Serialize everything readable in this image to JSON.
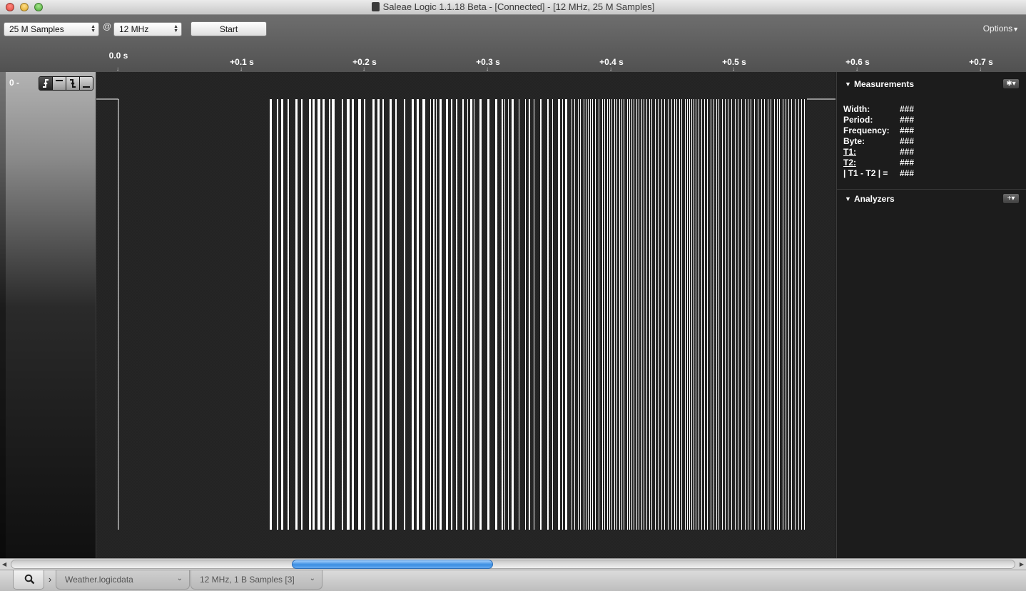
{
  "window": {
    "title": "Saleae Logic 1.1.18 Beta - [Connected] - [12 MHz, 25 M Samples]"
  },
  "toolbar": {
    "samples_value": "25 M Samples",
    "at_symbol": "@",
    "frequency_value": "12 MHz",
    "start_label": "Start",
    "options_label": "Options"
  },
  "ruler": {
    "ticks": [
      "0.0 s",
      "+0.1 s",
      "+0.2 s",
      "+0.3 s",
      "+0.4 s",
      "+0.5 s",
      "+0.6 s",
      "+0.7 s"
    ]
  },
  "channel": {
    "number": "0 -",
    "trigger_icons": [
      "rising-edge-icon",
      "high-level-icon",
      "falling-edge-icon",
      "low-level-icon"
    ]
  },
  "measurements": {
    "title": "Measurements",
    "rows": [
      {
        "label": "Width:",
        "value": "###"
      },
      {
        "label": "Period:",
        "value": "###"
      },
      {
        "label": "Frequency:",
        "value": "###"
      },
      {
        "label": "Byte:",
        "value": "###"
      },
      {
        "label": "T1:",
        "value": "###"
      },
      {
        "label": "T2:",
        "value": "###"
      },
      {
        "label": "| T1 - T2 | =",
        "value": "###"
      }
    ],
    "settings_icon": "gear-icon"
  },
  "analyzers": {
    "title": "Analyzers",
    "add_icon": "plus-icon"
  },
  "scrollbar": {
    "position_fraction": 0.28,
    "visible_fraction": 0.2
  },
  "bottom_tabs": {
    "search_icon": "search-icon",
    "file_tab": "Weather.logicdata",
    "session_tab": "12 MHz, 1 B Samples [3]"
  },
  "colors": {
    "signal": "#ffffff",
    "scroll_thumb": "#3b8de2"
  }
}
